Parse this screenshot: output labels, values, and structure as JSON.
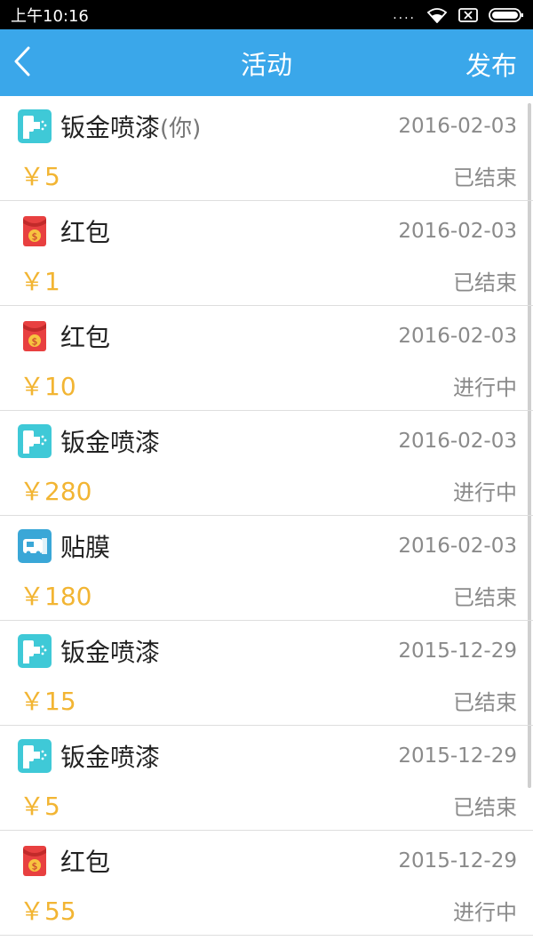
{
  "status_bar": {
    "time": "上午10:16",
    "signal_dots": "....",
    "icons": [
      "wifi-icon",
      "sim-none-icon",
      "battery-icon"
    ]
  },
  "header": {
    "back_icon": "chevron-left-icon",
    "title": "活动",
    "action": "发布"
  },
  "colors": {
    "header_bg": "#3aa7ea",
    "price": "#f2b533",
    "text_secondary": "#8a8a8a",
    "repair_icon": "#3fc9d7",
    "redpacket_icon": "#e84040",
    "film_icon": "#3aa7d7"
  },
  "activities": [
    {
      "icon": "spray-paint-icon",
      "title": "钣金喷漆",
      "you": "(你)",
      "date": "2016-02-03",
      "price": "￥5",
      "status": "已结束"
    },
    {
      "icon": "red-packet-icon",
      "title": "红包",
      "you": "",
      "date": "2016-02-03",
      "price": "￥1",
      "status": "已结束"
    },
    {
      "icon": "red-packet-icon",
      "title": "红包",
      "you": "",
      "date": "2016-02-03",
      "price": "￥10",
      "status": "进行中"
    },
    {
      "icon": "spray-paint-icon",
      "title": "钣金喷漆",
      "you": "",
      "date": "2016-02-03",
      "price": "￥280",
      "status": "进行中"
    },
    {
      "icon": "window-film-icon",
      "title": "贴膜",
      "you": "",
      "date": "2016-02-03",
      "price": "￥180",
      "status": "已结束"
    },
    {
      "icon": "spray-paint-icon",
      "title": "钣金喷漆",
      "you": "",
      "date": "2015-12-29",
      "price": "￥15",
      "status": "已结束"
    },
    {
      "icon": "spray-paint-icon",
      "title": "钣金喷漆",
      "you": "",
      "date": "2015-12-29",
      "price": "￥5",
      "status": "已结束"
    },
    {
      "icon": "red-packet-icon",
      "title": "红包",
      "you": "",
      "date": "2015-12-29",
      "price": "￥55",
      "status": "进行中"
    }
  ]
}
